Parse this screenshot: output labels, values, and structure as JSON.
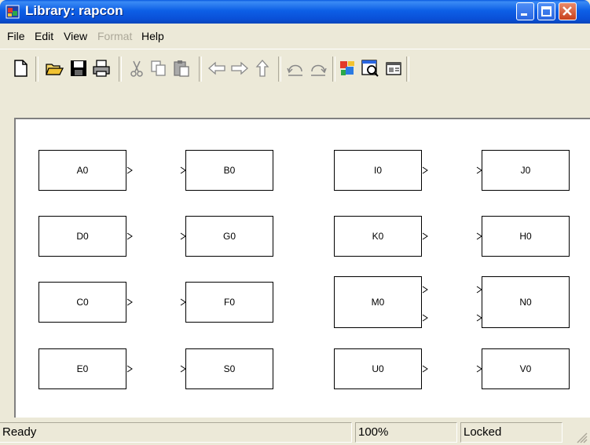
{
  "window": {
    "title": "Library: rapcon",
    "buttons": {
      "minimize": "minimize",
      "maximize": "maximize",
      "close": "close"
    }
  },
  "menu": [
    {
      "label": "File",
      "enabled": true
    },
    {
      "label": "Edit",
      "enabled": true
    },
    {
      "label": "View",
      "enabled": true
    },
    {
      "label": "Format",
      "enabled": false
    },
    {
      "label": "Help",
      "enabled": true
    }
  ],
  "toolbar": {
    "items": [
      "new-file-icon",
      "open-folder-icon",
      "save-icon",
      "print-icon",
      "cut-icon",
      "copy-icon",
      "paste-icon",
      "back-arrow-icon",
      "forward-arrow-icon",
      "up-arrow-icon",
      "undo-icon",
      "redo-icon",
      "library-browser-icon",
      "model-explorer-icon",
      "debugger-icon"
    ]
  },
  "blocks": [
    {
      "label": "A0"
    },
    {
      "label": "B0"
    },
    {
      "label": "I0"
    },
    {
      "label": "J0"
    },
    {
      "label": "D0"
    },
    {
      "label": "G0"
    },
    {
      "label": "K0"
    },
    {
      "label": "H0"
    },
    {
      "label": "C0"
    },
    {
      "label": "F0"
    },
    {
      "label": "M0"
    },
    {
      "label": "N0"
    },
    {
      "label": "E0"
    },
    {
      "label": "S0"
    },
    {
      "label": "U0"
    },
    {
      "label": "V0"
    }
  ],
  "status": {
    "message": "Ready",
    "zoom": "100%",
    "lock_state": "Locked"
  }
}
